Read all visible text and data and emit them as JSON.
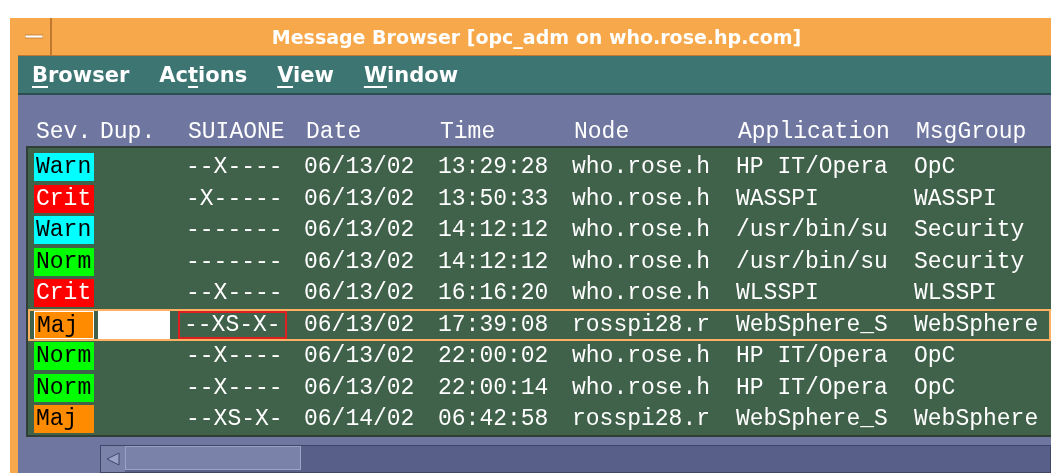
{
  "window": {
    "title": "Message Browser  [opc_adm on who.rose.hp.com]"
  },
  "menu": [
    {
      "key": "B",
      "after": "rowser"
    },
    {
      "before": "Ac",
      "key": "t",
      "after": "ions"
    },
    {
      "key": "V",
      "after": "iew"
    },
    {
      "key": "W",
      "after": "indow"
    }
  ],
  "table": {
    "columns": [
      "Sev.",
      "Dup.",
      "SUIAONE",
      "Date",
      "Time",
      "Node",
      "Application",
      "MsgGroup"
    ],
    "rows": [
      {
        "severity": "Warn",
        "color": "#00ffff",
        "flags": "--X----",
        "date": "06/13/02",
        "time": "13:29:28",
        "node": "who.rose.h",
        "application": "HP IT/Opera",
        "msggroup": "OpC",
        "selected": false,
        "annotated": false
      },
      {
        "severity": "Crit",
        "color": "#ff0000",
        "flags": "-X-----",
        "date": "06/13/02",
        "time": "13:50:33",
        "node": "who.rose.h",
        "application": "WASSPI",
        "msggroup": "WASSPI",
        "selected": false,
        "annotated": false
      },
      {
        "severity": "Warn",
        "color": "#00ffff",
        "flags": "-------",
        "date": "06/13/02",
        "time": "14:12:12",
        "node": "who.rose.h",
        "application": "/usr/bin/su",
        "msggroup": "Security",
        "selected": false,
        "annotated": false
      },
      {
        "severity": "Norm",
        "color": "#00ff00",
        "flags": "-------",
        "date": "06/13/02",
        "time": "14:12:12",
        "node": "who.rose.h",
        "application": "/usr/bin/su",
        "msggroup": "Security",
        "selected": false,
        "annotated": false
      },
      {
        "severity": "Crit",
        "color": "#ff0000",
        "flags": "--X----",
        "date": "06/13/02",
        "time": "16:16:20",
        "node": "who.rose.h",
        "application": "WLSSPI",
        "msggroup": "WLSSPI",
        "selected": false,
        "annotated": false
      },
      {
        "severity": "Maj",
        "color": "#ff8c00",
        "flags": "--XS-X-",
        "date": "06/13/02",
        "time": "17:39:08",
        "node": "rosspi28.r",
        "application": "WebSphere_S",
        "msggroup": "WebSphere",
        "selected": true,
        "annotated": true
      },
      {
        "severity": "Norm",
        "color": "#00ff00",
        "flags": "--X----",
        "date": "06/13/02",
        "time": "22:00:02",
        "node": "who.rose.h",
        "application": "HP IT/Opera",
        "msggroup": "OpC",
        "selected": false,
        "annotated": false
      },
      {
        "severity": "Norm",
        "color": "#00ff00",
        "flags": "--X----",
        "date": "06/13/02",
        "time": "22:00:14",
        "node": "who.rose.h",
        "application": "HP IT/Opera",
        "msggroup": "OpC",
        "selected": false,
        "annotated": false
      },
      {
        "severity": "Maj",
        "color": "#ff8c00",
        "flags": "--XS-X-",
        "date": "06/14/02",
        "time": "06:42:58",
        "node": "rosspi28.r",
        "application": "WebSphere_S",
        "msggroup": "WebSphere",
        "selected": false,
        "annotated": false
      }
    ]
  }
}
